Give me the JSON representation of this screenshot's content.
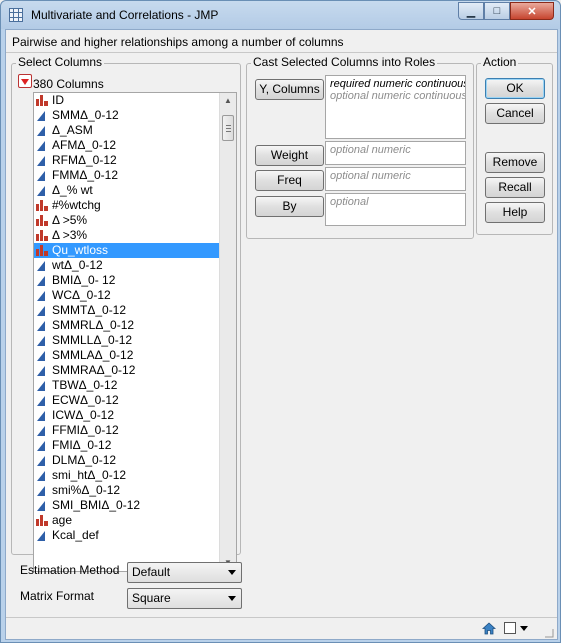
{
  "window": {
    "title": "Multivariate and Correlations - JMP",
    "controls": [
      "minimize",
      "maximize",
      "close"
    ]
  },
  "hint": "Pairwise and higher relationships among a number of columns",
  "select_columns": {
    "group_label": "Select Columns",
    "count_label": "380 Columns",
    "items": [
      {
        "label": "ID",
        "icon": "nominal-bar-icon",
        "selected": false
      },
      {
        "label": "SMMΔ_0-12",
        "icon": "continuous-triangle-icon",
        "selected": false
      },
      {
        "label": "Δ_ASM",
        "icon": "continuous-triangle-icon",
        "selected": false
      },
      {
        "label": "AFMΔ_0-12",
        "icon": "continuous-triangle-icon",
        "selected": false
      },
      {
        "label": "RFMΔ_0-12",
        "icon": "continuous-triangle-icon",
        "selected": false
      },
      {
        "label": "FMMΔ_0-12",
        "icon": "continuous-triangle-icon",
        "selected": false
      },
      {
        "label": "Δ_% wt",
        "icon": "continuous-triangle-icon",
        "selected": false
      },
      {
        "label": "#%wtchg",
        "icon": "nominal-bar-icon",
        "selected": false
      },
      {
        "label": "Δ >5%",
        "icon": "nominal-bar-icon",
        "selected": false
      },
      {
        "label": "Δ >3%",
        "icon": "nominal-bar-icon",
        "selected": false
      },
      {
        "label": "Qu_wtloss",
        "icon": "nominal-bar-icon",
        "selected": true
      },
      {
        "label": "wtΔ_0-12",
        "icon": "continuous-triangle-icon",
        "selected": false
      },
      {
        "label": "BMIΔ_0- 12",
        "icon": "continuous-triangle-icon",
        "selected": false
      },
      {
        "label": "WCΔ_0-12",
        "icon": "continuous-triangle-icon",
        "selected": false
      },
      {
        "label": "SMMTΔ_0-12",
        "icon": "continuous-triangle-icon",
        "selected": false
      },
      {
        "label": "SMMRLΔ_0-12",
        "icon": "continuous-triangle-icon",
        "selected": false
      },
      {
        "label": "SMMLLΔ_0-12",
        "icon": "continuous-triangle-icon",
        "selected": false
      },
      {
        "label": "SMMLAΔ_0-12",
        "icon": "continuous-triangle-icon",
        "selected": false
      },
      {
        "label": "SMMRAΔ_0-12",
        "icon": "continuous-triangle-icon",
        "selected": false
      },
      {
        "label": "TBWΔ_0-12",
        "icon": "continuous-triangle-icon",
        "selected": false
      },
      {
        "label": "ECWΔ_0-12",
        "icon": "continuous-triangle-icon",
        "selected": false
      },
      {
        "label": "ICWΔ_0-12",
        "icon": "continuous-triangle-icon",
        "selected": false
      },
      {
        "label": "FFMIΔ_0-12",
        "icon": "continuous-triangle-icon",
        "selected": false
      },
      {
        "label": "FMIΔ_0-12",
        "icon": "continuous-triangle-icon",
        "selected": false
      },
      {
        "label": "DLMΔ_0-12",
        "icon": "continuous-triangle-icon",
        "selected": false
      },
      {
        "label": "smi_htΔ_0-12",
        "icon": "continuous-triangle-icon",
        "selected": false
      },
      {
        "label": "smi%Δ_0-12",
        "icon": "continuous-triangle-icon",
        "selected": false
      },
      {
        "label": "SMI_BMIΔ_0-12",
        "icon": "continuous-triangle-icon",
        "selected": false
      },
      {
        "label": "age",
        "icon": "nominal-bar-icon",
        "selected": false
      },
      {
        "label": "Kcal_def",
        "icon": "continuous-triangle-icon",
        "selected": false
      }
    ]
  },
  "cast_roles": {
    "group_label": "Cast Selected Columns into Roles",
    "y_columns": {
      "button": "Y, Columns",
      "required": "required numeric continuous",
      "optional": "optional numeric continuous"
    },
    "weight": {
      "button": "Weight",
      "hint": "optional numeric"
    },
    "freq": {
      "button": "Freq",
      "hint": "optional numeric"
    },
    "by": {
      "button": "By",
      "hint": "optional"
    }
  },
  "action": {
    "group_label": "Action",
    "ok": "OK",
    "cancel": "Cancel",
    "remove": "Remove",
    "recall": "Recall",
    "help": "Help"
  },
  "options": {
    "estimation_method": {
      "label": "Estimation Method",
      "value": "Default"
    },
    "matrix_format": {
      "label": "Matrix Format",
      "value": "Square"
    }
  },
  "colors": {
    "selection": "#3399ff",
    "nominal_icon": "#c0392b",
    "continuous_icon": "#2e5fa8"
  }
}
